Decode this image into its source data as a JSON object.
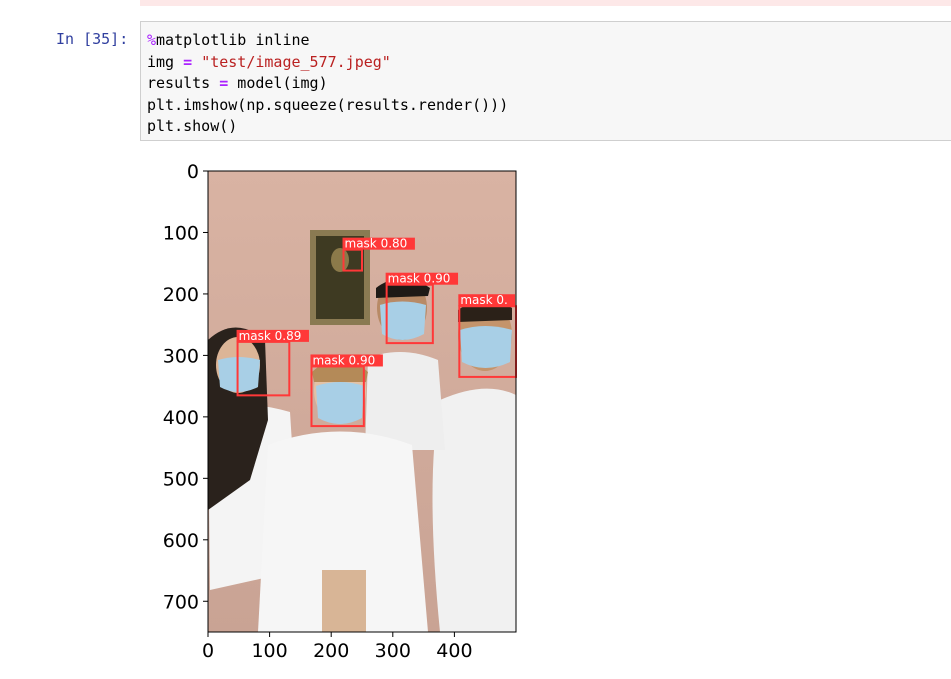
{
  "prompt": "In [35]:",
  "code": {
    "line1": {
      "magic": "%",
      "rest": "matplotlib inline"
    },
    "line2": {
      "var": "img ",
      "op": "=",
      "str": "\"test/image_577.jpeg\""
    },
    "line3": {
      "var": "results ",
      "op": "=",
      "rest": " model(img)"
    },
    "line4": "plt.imshow(np.squeeze(results.render()))",
    "line5": "plt.show()"
  },
  "chart_data": {
    "type": "image",
    "xlim": [
      0,
      500
    ],
    "ylim": [
      750,
      0
    ],
    "xticks": [
      "0",
      "100",
      "200",
      "300",
      "400"
    ],
    "yticks": [
      "0",
      "100",
      "200",
      "300",
      "400",
      "500",
      "600",
      "700"
    ],
    "detections": [
      {
        "label": "mask 0.80",
        "x1": 220,
        "y1": 128,
        "x2": 250,
        "y2": 162
      },
      {
        "label": "mask 0.90",
        "x1": 290,
        "y1": 185,
        "x2": 365,
        "y2": 280
      },
      {
        "label": "mask 0.",
        "x1": 408,
        "y1": 220,
        "x2": 500,
        "y2": 335
      },
      {
        "label": "mask 0.89",
        "x1": 48,
        "y1": 278,
        "x2": 132,
        "y2": 365
      },
      {
        "label": "mask 0.90",
        "x1": 168,
        "y1": 318,
        "x2": 253,
        "y2": 415
      }
    ]
  },
  "colors": {
    "box": "#ff3838",
    "label_text": "#ffffff",
    "prompt": "#303f9f"
  }
}
